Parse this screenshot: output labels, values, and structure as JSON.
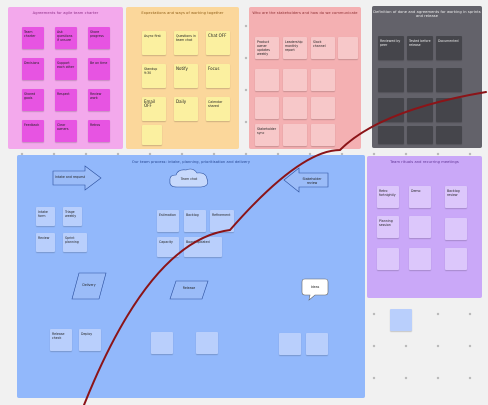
{
  "colors": {
    "board_background": "#f1f1f1",
    "connector": "#8b1418",
    "pink_frame": "#f3a9ec",
    "pink_note": "#e754e2",
    "yellow_frame": "#fbd79b",
    "yellow_note": "#fbf0a0",
    "yellow_note_alt": "#ffe8b4",
    "red_frame": "#f4b0b2",
    "red_note": "#f7c8c9",
    "dark_frame": "#63626a",
    "dark_note": "#45454b",
    "blue_frame": "#92b8fb",
    "blue_note": "#b9cffc",
    "blue_note_alt": "#c9dbff",
    "violet_frame": "#caa8f8",
    "violet_note": "#dcc7fb"
  },
  "frames": {
    "pink": {
      "title": "Agreements for agile team charter"
    },
    "yellow": {
      "title": "Expectations and ways of working together"
    },
    "red": {
      "title": "Who are the stakeholders and how do we communicate"
    },
    "dark": {
      "title": "Definition of done and agreements for working in sprints and release"
    },
    "blue": {
      "title": "Our team process: intake, planning, prioritisation and delivery"
    },
    "violet": {
      "title": "Team rituals and recurring meetings"
    }
  },
  "notes": {
    "pink": [
      "Team charter",
      "Ask questions if unsure",
      "Share progress",
      "Decisions",
      "Support each other",
      "Be on time",
      "Shared goals",
      "Respect",
      "Review work",
      "Feedback",
      "Clear owners",
      "Retros",
      "Trust",
      "Openness",
      "Focus"
    ],
    "yellow": [
      "Async first",
      "Questions in team chat",
      "Chat OFF",
      "Standup 9:30",
      "Notify",
      "Focus",
      "Email OFF",
      "Daily",
      "Calendar shared"
    ],
    "red": [
      "Product owner updates weekly",
      "Leadership monthly report",
      "Slack channel",
      "Stakeholder sync"
    ],
    "dark": [
      "Reviewed by peer",
      "Tested before release",
      "Documented"
    ],
    "blue": [
      "Intake form",
      "Triage weekly",
      "Review",
      "Sprint planning",
      "Estimation",
      "Backlog",
      "Refinement",
      "Capacity",
      "Board updated",
      "Release check",
      "Deploy"
    ],
    "violet": [
      "Retro fortnightly",
      "Demo",
      "Backlog review",
      "Planning session"
    ]
  },
  "shapes": {
    "arrow_left": "Intake and request",
    "cloud": "Team chat",
    "arrow_right": "Stakeholder review",
    "parallelogram_left": "Delivery",
    "parallelogram_mid": "Release",
    "speech_bubble": "Ideas"
  }
}
